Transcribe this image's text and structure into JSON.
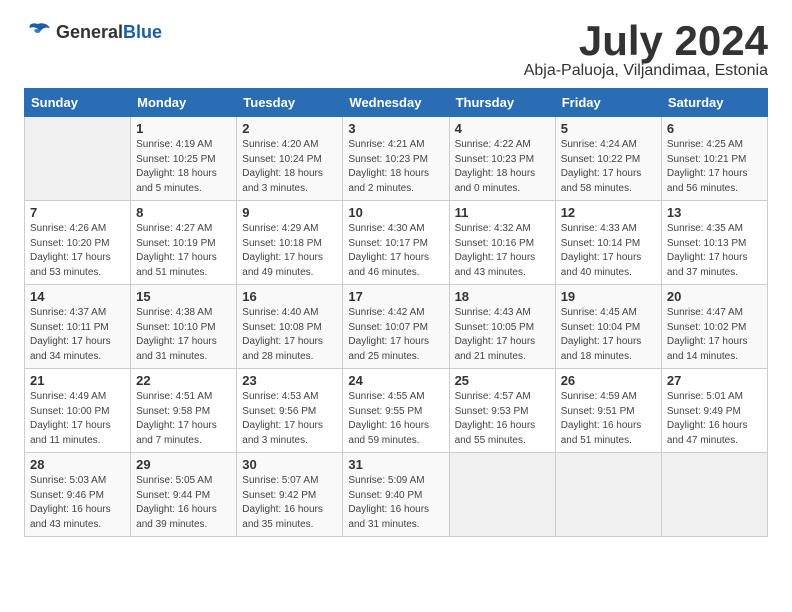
{
  "logo": {
    "general": "General",
    "blue": "Blue"
  },
  "header": {
    "month": "July 2024",
    "location": "Abja-Paluoja, Viljandimaa, Estonia"
  },
  "days_of_week": [
    "Sunday",
    "Monday",
    "Tuesday",
    "Wednesday",
    "Thursday",
    "Friday",
    "Saturday"
  ],
  "weeks": [
    [
      {
        "date": "",
        "info": ""
      },
      {
        "date": "1",
        "info": "Sunrise: 4:19 AM\nSunset: 10:25 PM\nDaylight: 18 hours\nand 5 minutes."
      },
      {
        "date": "2",
        "info": "Sunrise: 4:20 AM\nSunset: 10:24 PM\nDaylight: 18 hours\nand 3 minutes."
      },
      {
        "date": "3",
        "info": "Sunrise: 4:21 AM\nSunset: 10:23 PM\nDaylight: 18 hours\nand 2 minutes."
      },
      {
        "date": "4",
        "info": "Sunrise: 4:22 AM\nSunset: 10:23 PM\nDaylight: 18 hours\nand 0 minutes."
      },
      {
        "date": "5",
        "info": "Sunrise: 4:24 AM\nSunset: 10:22 PM\nDaylight: 17 hours\nand 58 minutes."
      },
      {
        "date": "6",
        "info": "Sunrise: 4:25 AM\nSunset: 10:21 PM\nDaylight: 17 hours\nand 56 minutes."
      }
    ],
    [
      {
        "date": "7",
        "info": "Sunrise: 4:26 AM\nSunset: 10:20 PM\nDaylight: 17 hours\nand 53 minutes."
      },
      {
        "date": "8",
        "info": "Sunrise: 4:27 AM\nSunset: 10:19 PM\nDaylight: 17 hours\nand 51 minutes."
      },
      {
        "date": "9",
        "info": "Sunrise: 4:29 AM\nSunset: 10:18 PM\nDaylight: 17 hours\nand 49 minutes."
      },
      {
        "date": "10",
        "info": "Sunrise: 4:30 AM\nSunset: 10:17 PM\nDaylight: 17 hours\nand 46 minutes."
      },
      {
        "date": "11",
        "info": "Sunrise: 4:32 AM\nSunset: 10:16 PM\nDaylight: 17 hours\nand 43 minutes."
      },
      {
        "date": "12",
        "info": "Sunrise: 4:33 AM\nSunset: 10:14 PM\nDaylight: 17 hours\nand 40 minutes."
      },
      {
        "date": "13",
        "info": "Sunrise: 4:35 AM\nSunset: 10:13 PM\nDaylight: 17 hours\nand 37 minutes."
      }
    ],
    [
      {
        "date": "14",
        "info": "Sunrise: 4:37 AM\nSunset: 10:11 PM\nDaylight: 17 hours\nand 34 minutes."
      },
      {
        "date": "15",
        "info": "Sunrise: 4:38 AM\nSunset: 10:10 PM\nDaylight: 17 hours\nand 31 minutes."
      },
      {
        "date": "16",
        "info": "Sunrise: 4:40 AM\nSunset: 10:08 PM\nDaylight: 17 hours\nand 28 minutes."
      },
      {
        "date": "17",
        "info": "Sunrise: 4:42 AM\nSunset: 10:07 PM\nDaylight: 17 hours\nand 25 minutes."
      },
      {
        "date": "18",
        "info": "Sunrise: 4:43 AM\nSunset: 10:05 PM\nDaylight: 17 hours\nand 21 minutes."
      },
      {
        "date": "19",
        "info": "Sunrise: 4:45 AM\nSunset: 10:04 PM\nDaylight: 17 hours\nand 18 minutes."
      },
      {
        "date": "20",
        "info": "Sunrise: 4:47 AM\nSunset: 10:02 PM\nDaylight: 17 hours\nand 14 minutes."
      }
    ],
    [
      {
        "date": "21",
        "info": "Sunrise: 4:49 AM\nSunset: 10:00 PM\nDaylight: 17 hours\nand 11 minutes."
      },
      {
        "date": "22",
        "info": "Sunrise: 4:51 AM\nSunset: 9:58 PM\nDaylight: 17 hours\nand 7 minutes."
      },
      {
        "date": "23",
        "info": "Sunrise: 4:53 AM\nSunset: 9:56 PM\nDaylight: 17 hours\nand 3 minutes."
      },
      {
        "date": "24",
        "info": "Sunrise: 4:55 AM\nSunset: 9:55 PM\nDaylight: 16 hours\nand 59 minutes."
      },
      {
        "date": "25",
        "info": "Sunrise: 4:57 AM\nSunset: 9:53 PM\nDaylight: 16 hours\nand 55 minutes."
      },
      {
        "date": "26",
        "info": "Sunrise: 4:59 AM\nSunset: 9:51 PM\nDaylight: 16 hours\nand 51 minutes."
      },
      {
        "date": "27",
        "info": "Sunrise: 5:01 AM\nSunset: 9:49 PM\nDaylight: 16 hours\nand 47 minutes."
      }
    ],
    [
      {
        "date": "28",
        "info": "Sunrise: 5:03 AM\nSunset: 9:46 PM\nDaylight: 16 hours\nand 43 minutes."
      },
      {
        "date": "29",
        "info": "Sunrise: 5:05 AM\nSunset: 9:44 PM\nDaylight: 16 hours\nand 39 minutes."
      },
      {
        "date": "30",
        "info": "Sunrise: 5:07 AM\nSunset: 9:42 PM\nDaylight: 16 hours\nand 35 minutes."
      },
      {
        "date": "31",
        "info": "Sunrise: 5:09 AM\nSunset: 9:40 PM\nDaylight: 16 hours\nand 31 minutes."
      },
      {
        "date": "",
        "info": ""
      },
      {
        "date": "",
        "info": ""
      },
      {
        "date": "",
        "info": ""
      }
    ]
  ]
}
